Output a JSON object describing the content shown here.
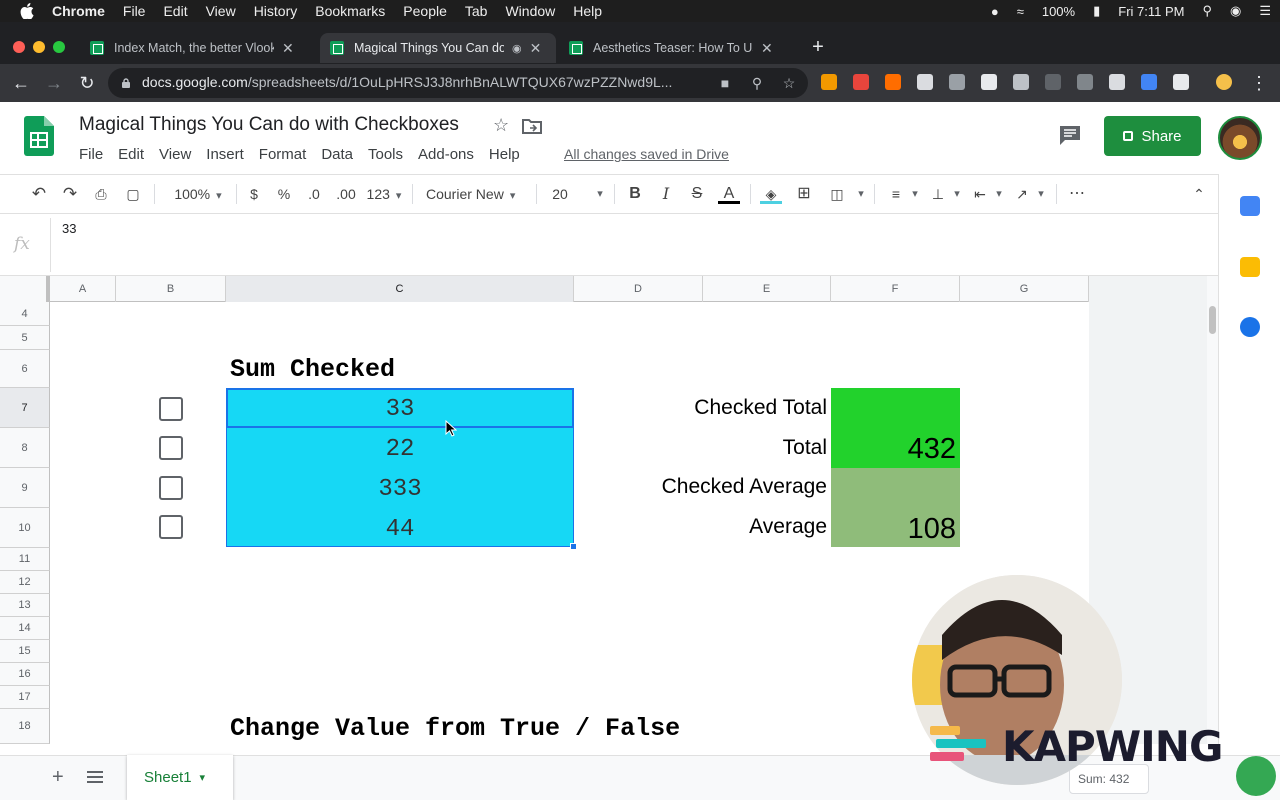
{
  "mac_menu": {
    "app": "Chrome",
    "items": [
      "File",
      "Edit",
      "View",
      "History",
      "Bookmarks",
      "People",
      "Tab",
      "Window",
      "Help"
    ],
    "battery": "100%",
    "clock": "Fri 7:11 PM"
  },
  "tabs": [
    {
      "title": "Index Match, the better Vlooku"
    },
    {
      "title": "Magical Things You Can do"
    },
    {
      "title": "Aesthetics Teaser: How To Use"
    }
  ],
  "url": {
    "host": "docs.google.com",
    "path": "/spreadsheets/d/1OuLpHRSJ3J8nrhBnALWTQUX67wzPZZNwd9L..."
  },
  "doc": {
    "title": "Magical Things You Can do with Checkboxes",
    "menu": [
      "File",
      "Edit",
      "View",
      "Insert",
      "Format",
      "Data",
      "Tools",
      "Add-ons",
      "Help"
    ],
    "saved_status": "All changes saved in Drive",
    "share_label": "Share"
  },
  "toolbar": {
    "zoom": "100%",
    "currency": "$",
    "percent": "%",
    "dec_less": ".0",
    "dec_more": ".00",
    "format": "123",
    "font": "Courier New",
    "font_size": "20",
    "bold": "B",
    "italic": "I",
    "strike": "S",
    "text_color": "A"
  },
  "formula_bar": {
    "label": "fx",
    "value": "33"
  },
  "columns": [
    "A",
    "B",
    "C",
    "D",
    "E",
    "F",
    "G"
  ],
  "rows": [
    "4",
    "5",
    "6",
    "7",
    "8",
    "9",
    "10",
    "11",
    "12",
    "13",
    "14",
    "15",
    "16",
    "17",
    "18"
  ],
  "sheet": {
    "heading1": "Sum Checked",
    "heading2": "Change Value from True / False",
    "values": [
      "33",
      "22",
      "333",
      "44"
    ],
    "labels": [
      "Checked Total",
      "Total",
      "Checked Average",
      "Average"
    ],
    "results": [
      "",
      "432",
      "",
      "108"
    ]
  },
  "colors": {
    "value_fill": "#16d8f5",
    "checked_total_fill": "#22d22c",
    "average_fill": "#8fbc7a",
    "sheets_green": "#0f9d58",
    "share_green": "#1e8e3e"
  },
  "bottom": {
    "add": "+",
    "sheet_tab": "Sheet1",
    "sum": "Sum: 432"
  },
  "watermark": "KAPWING"
}
